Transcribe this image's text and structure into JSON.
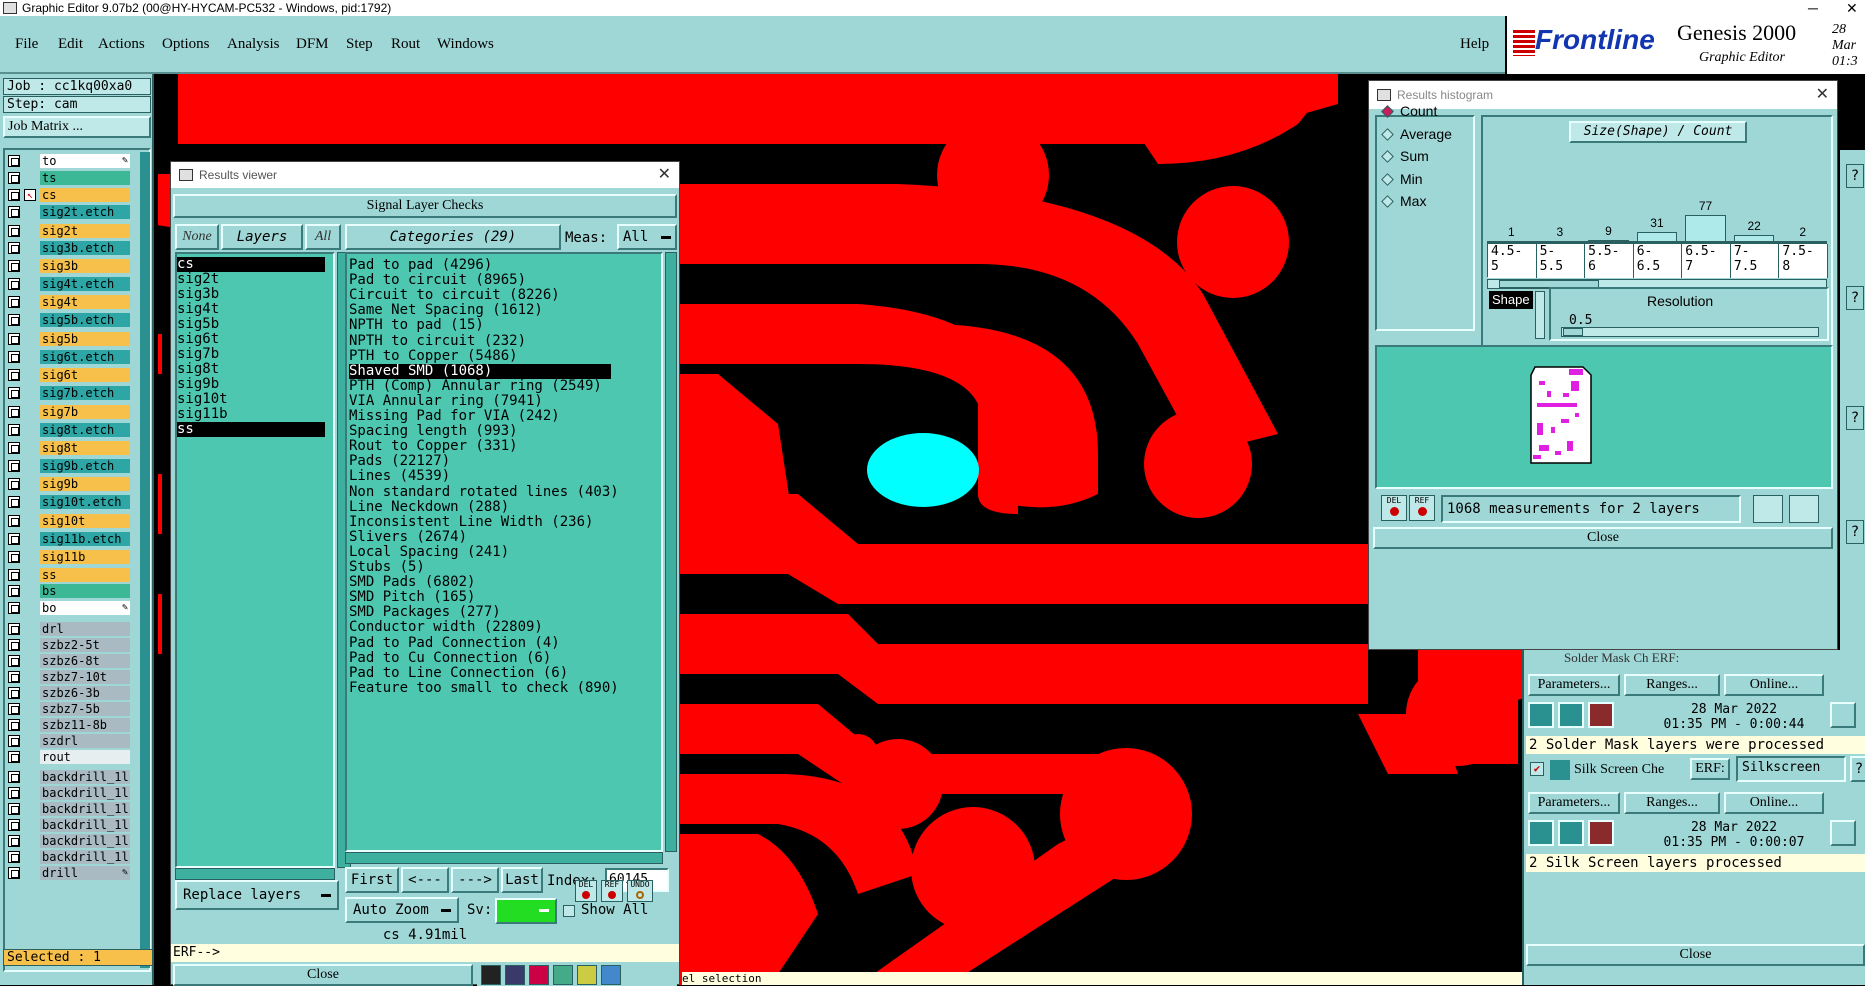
{
  "window": {
    "title": "Graphic Editor 9.07b2 (00@HY-HYCAM-PC532 - Windows, pid:1792)",
    "minimize": "─",
    "close": "✕"
  },
  "menu": {
    "items": [
      "File",
      "Edit",
      "Actions",
      "Options",
      "Analysis",
      "DFM",
      "Step",
      "Rout",
      "Windows"
    ],
    "help": "Help"
  },
  "brand": {
    "logo": "Frontline",
    "product": "Genesis 2000",
    "subtitle": "Graphic Editor",
    "date_line1": "28 Mar",
    "date_line2": "01:3"
  },
  "left": {
    "job": "Job : cc1kq00xa0",
    "step": "Step: cam",
    "job_matrix": "Job Matrix ...",
    "selected": "Selected : 1",
    "layers": [
      {
        "name": "to",
        "color": "#ffffff",
        "icon": "pencil-icon"
      },
      {
        "name": "ts",
        "color": "#3cb896"
      },
      {
        "name": "cs",
        "color": "#f6c04a",
        "affected": true
      },
      {
        "name": "sig2t.etch",
        "color": "#2ea6a6"
      },
      {
        "name": "sig2t",
        "color": "#f6c04a"
      },
      {
        "name": "sig3b.etch",
        "color": "#2ea6a6"
      },
      {
        "name": "sig3b",
        "color": "#f6c04a"
      },
      {
        "name": "sig4t.etch",
        "color": "#2ea6a6"
      },
      {
        "name": "sig4t",
        "color": "#f6c04a"
      },
      {
        "name": "sig5b.etch",
        "color": "#2ea6a6"
      },
      {
        "name": "sig5b",
        "color": "#f6c04a"
      },
      {
        "name": "sig6t.etch",
        "color": "#2ea6a6"
      },
      {
        "name": "sig6t",
        "color": "#f6c04a"
      },
      {
        "name": "sig7b.etch",
        "color": "#2ea6a6"
      },
      {
        "name": "sig7b",
        "color": "#f6c04a"
      },
      {
        "name": "sig8t.etch",
        "color": "#2ea6a6"
      },
      {
        "name": "sig8t",
        "color": "#f6c04a"
      },
      {
        "name": "sig9b.etch",
        "color": "#2ea6a6"
      },
      {
        "name": "sig9b",
        "color": "#f6c04a"
      },
      {
        "name": "sig10t.etch",
        "color": "#2ea6a6"
      },
      {
        "name": "sig10t",
        "color": "#f6c04a"
      },
      {
        "name": "sig11b.etch",
        "color": "#2ea6a6"
      },
      {
        "name": "sig11b",
        "color": "#f6c04a"
      },
      {
        "name": "ss",
        "color": "#f6c04a"
      },
      {
        "name": "bs",
        "color": "#3cb896"
      },
      {
        "name": "bo",
        "color": "#ffffff",
        "icon": "pencil-icon"
      },
      {
        "name": "drl",
        "color": "#a9bac2"
      },
      {
        "name": "szbz2-5t",
        "color": "#a9bac2"
      },
      {
        "name": "szbz6-8t",
        "color": "#a9bac2"
      },
      {
        "name": "szbz7-10t",
        "color": "#a9bac2"
      },
      {
        "name": "szbz6-3b",
        "color": "#a9bac2"
      },
      {
        "name": "szbz7-5b",
        "color": "#a9bac2"
      },
      {
        "name": "szbz11-8b",
        "color": "#a9bac2"
      },
      {
        "name": "szdrl",
        "color": "#a9bac2"
      },
      {
        "name": "rout",
        "color": "#e6eef0"
      },
      {
        "name": "backdrill_1l",
        "color": "#a9bac2"
      },
      {
        "name": "backdrill_1l",
        "color": "#a9bac2"
      },
      {
        "name": "backdrill_1l",
        "color": "#a9bac2"
      },
      {
        "name": "backdrill_1l",
        "color": "#a9bac2"
      },
      {
        "name": "backdrill_1l",
        "color": "#a9bac2"
      },
      {
        "name": "backdrill_1l",
        "color": "#a9bac2"
      },
      {
        "name": "drill",
        "color": "#a9bac2",
        "icon": "pencil-icon"
      }
    ]
  },
  "results_viewer": {
    "title": "Results viewer",
    "header": "Signal Layer Checks",
    "none": "None",
    "layers_label": "Layers",
    "all": "All",
    "categories_label": "Categories (29)",
    "meas_label": "Meas:",
    "meas_value": "All",
    "layers": [
      "cs",
      "sig2t",
      "sig3b",
      "sig4t",
      "sig5b",
      "sig6t",
      "sig7b",
      "sig8t",
      "sig9b",
      "sig10t",
      "sig11b",
      "ss"
    ],
    "selected_layers": [
      "cs",
      "ss"
    ],
    "categories": [
      "Pad to pad (4296)",
      "Pad to circuit (8965)",
      "Circuit to circuit (8226)",
      "Same Net Spacing (1612)",
      "NPTH to pad (15)",
      "NPTH to circuit (232)",
      "PTH to Copper (5486)",
      "Shaved SMD (1068)",
      "PTH (Comp) Annular ring (2549)",
      "VIA Annular ring (7941)",
      "Missing Pad for VIA (242)",
      "Spacing length (993)",
      "Rout to Copper (331)",
      "Pads (22127)",
      "Lines (4539)",
      "Non standard rotated lines (403)",
      "Line Neckdown (288)",
      "Inconsistent Line Width (236)",
      "Slivers (2674)",
      "Local Spacing (241)",
      "Stubs (5)",
      "SMD Pads (6802)",
      "SMD Pitch (165)",
      "SMD Packages (277)",
      "Conductor width (22809)",
      "Pad to Pad Connection (4)",
      "Pad to Cu Connection (6)",
      "Pad to Line Connection (6)",
      "Feature too small to check (890)"
    ],
    "selected_category": "Shaved SMD (1068)",
    "first": "First",
    "prev": "<---",
    "next": "--->",
    "last": "Last",
    "index_label": "Index:",
    "index_value": "60145",
    "auto_zoom": "Auto Zoom",
    "sv_label": "Sv:",
    "show_all": "Show All",
    "replace_layers": "Replace layers",
    "status": "cs 4.91mil",
    "erf": "ERF-->",
    "close": "Close",
    "del": "DEL",
    "ref": "REF",
    "undo": "UNDO"
  },
  "histogram": {
    "title": "Results histogram",
    "modes": [
      "Count",
      "Average",
      "Sum",
      "Min",
      "Max"
    ],
    "selected_mode": "Count",
    "chart_title": "Size(Shape) / Count",
    "shape_label": "Shape",
    "resolution_label": "Resolution",
    "resolution_value": "0.5",
    "measurements": "1068 measurements for 2 layers",
    "close": "Close",
    "del": "DEL",
    "ref": "REF"
  },
  "chart_data": {
    "type": "bar",
    "title": "Size(Shape) / Count",
    "categories": [
      "4.5-5",
      "5-5.5",
      "5.5-6",
      "6-6.5",
      "6.5-7",
      "7-7.5",
      "7.5-8"
    ],
    "values": [
      1,
      3,
      9,
      31,
      77,
      22,
      2
    ],
    "ylim": [
      0,
      77
    ]
  },
  "right_panel": {
    "partial_label": "Solder Mask Ch ERF:",
    "parameters": "Parameters...",
    "ranges": "Ranges...",
    "online": "Online...",
    "sm_date": "28 Mar 2022",
    "sm_time": "01:35 PM - 0:00:44",
    "sm_result": "2 Solder Mask layers were processed",
    "ss_title": "Silk Screen Che",
    "erf_label": "ERF:",
    "erf_value": "Silkscreen",
    "ss_date": "28 Mar 2022",
    "ss_time": "01:35 PM - 0:00:07",
    "ss_result": "2 Silk Screen layers processed",
    "close": "Close",
    "help_icon": "?"
  },
  "bottom_hint": "el selection"
}
